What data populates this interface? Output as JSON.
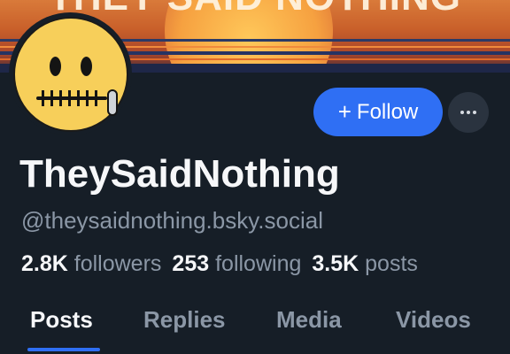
{
  "banner": {
    "text": "THEY SAID NOTHING"
  },
  "profile": {
    "display_name": "TheySaidNothing",
    "handle": "@theysaidnothing.bsky.social",
    "avatar_icon": "zipper-mouth-face-icon"
  },
  "actions": {
    "follow_label": "Follow",
    "follow_plus": "+",
    "more_icon": "ellipsis-icon"
  },
  "stats": {
    "followers_count": "2.8K",
    "followers_label": "followers",
    "following_count": "253",
    "following_label": "following",
    "posts_count": "3.5K",
    "posts_label": "posts"
  },
  "tabs": [
    {
      "label": "Posts",
      "active": true
    },
    {
      "label": "Replies",
      "active": false
    },
    {
      "label": "Media",
      "active": false
    },
    {
      "label": "Videos",
      "active": false
    }
  ],
  "colors": {
    "accent": "#2f6ff4",
    "background": "#161e27",
    "muted_text": "#8b97a6",
    "avatar_yellow": "#f7cf5a"
  }
}
